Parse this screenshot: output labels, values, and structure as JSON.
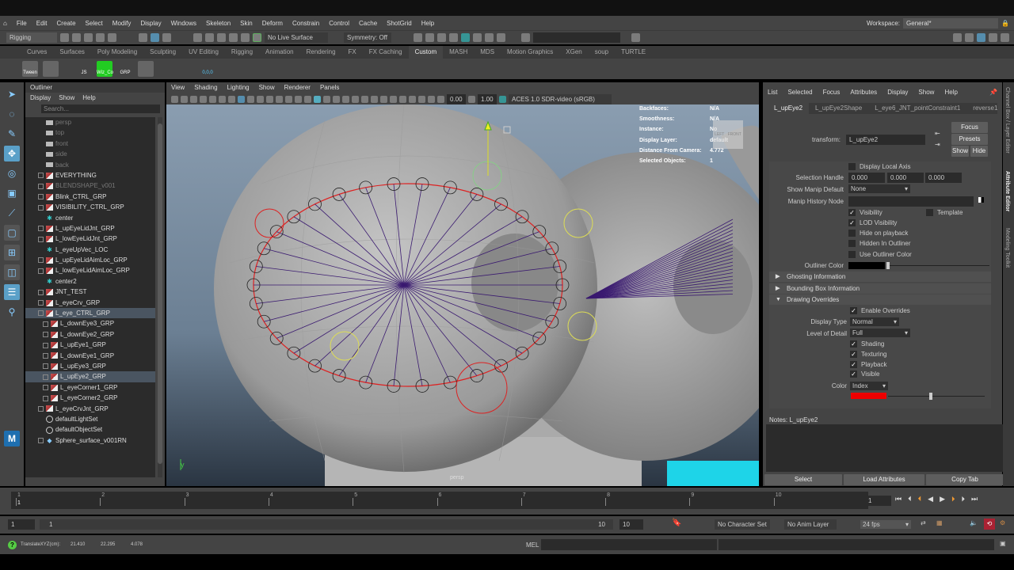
{
  "menubar": {
    "items": [
      "File",
      "Edit",
      "Create",
      "Select",
      "Modify",
      "Display",
      "Windows",
      "Skeleton",
      "Skin",
      "Deform",
      "Constrain",
      "Control",
      "Cache",
      "ShotGrid",
      "Help"
    ],
    "workspace_label": "Workspace:",
    "workspace_value": "General*"
  },
  "status_line": {
    "mode": "Rigging",
    "live_surface": "No Live Surface",
    "symmetry": "Symmetry: Off"
  },
  "shelf": {
    "tabs": [
      "Curves",
      "Surfaces",
      "Poly Modeling",
      "Sculpting",
      "UV Editing",
      "Rigging",
      "Animation",
      "Rendering",
      "FX",
      "FX Caching",
      "Custom",
      "MASH",
      "MDS",
      "Motion Graphics",
      "XGen",
      "soup",
      "TURTLE"
    ],
    "active_tab": "Custom",
    "buttons": [
      "Tween",
      "",
      "JS",
      "Wiz_Co",
      "GRP",
      "",
      "",
      "",
      "0,0,0"
    ]
  },
  "outliner": {
    "title": "Outliner",
    "menu": [
      "Display",
      "Show",
      "Help"
    ],
    "search_placeholder": "Search...",
    "items": [
      {
        "label": "persp",
        "type": "camera",
        "indent": 1,
        "dim": true
      },
      {
        "label": "top",
        "type": "camera",
        "indent": 1,
        "dim": true
      },
      {
        "label": "front",
        "type": "camera",
        "indent": 1,
        "dim": true
      },
      {
        "label": "side",
        "type": "camera",
        "indent": 1,
        "dim": true
      },
      {
        "label": "back",
        "type": "camera",
        "indent": 1,
        "dim": true
      },
      {
        "label": "EVERYTHING",
        "type": "group",
        "indent": 0
      },
      {
        "label": "BLENDSHAPE_v001",
        "type": "group",
        "indent": 0,
        "dim": true
      },
      {
        "label": "Blink_CTRL_GRP",
        "type": "group",
        "indent": 0
      },
      {
        "label": "VISIBILITY_CTRL_GRP",
        "type": "group",
        "indent": 0
      },
      {
        "label": "center",
        "type": "locator",
        "indent": 1
      },
      {
        "label": "L_upEyeLidJnt_GRP",
        "type": "group",
        "indent": 0
      },
      {
        "label": "L_lowEyeLidJnt_GRP",
        "type": "group",
        "indent": 0
      },
      {
        "label": "L_eyeUpVec_LOC",
        "type": "locator",
        "indent": 1
      },
      {
        "label": "L_upEyeLidAimLoc_GRP",
        "type": "group",
        "indent": 0
      },
      {
        "label": "L_lowEyeLidAimLoc_GRP",
        "type": "group",
        "indent": 0
      },
      {
        "label": "center2",
        "type": "locator",
        "indent": 1
      },
      {
        "label": "JNT_TEST",
        "type": "group",
        "indent": 0
      },
      {
        "label": "L_eyeCrv_GRP",
        "type": "group",
        "indent": 0
      },
      {
        "label": "L_eye_CTRL_GRP",
        "type": "group",
        "indent": 0,
        "selected": true
      },
      {
        "label": "L_downEye3_GRP",
        "type": "group",
        "indent": 2
      },
      {
        "label": "L_downEye2_GRP",
        "type": "group",
        "indent": 2
      },
      {
        "label": "L_upEye1_GRP",
        "type": "group",
        "indent": 2
      },
      {
        "label": "L_downEye1_GRP",
        "type": "group",
        "indent": 2
      },
      {
        "label": "L_upEye3_GRP",
        "type": "group",
        "indent": 2
      },
      {
        "label": "L_upEye2_GRP",
        "type": "group",
        "indent": 2,
        "selected": true
      },
      {
        "label": "L_eyeCorner1_GRP",
        "type": "group",
        "indent": 2
      },
      {
        "label": "L_eyeCorner2_GRP",
        "type": "group",
        "indent": 2
      },
      {
        "label": "L_eyeCrvJnt_GRP",
        "type": "group",
        "indent": 0
      },
      {
        "label": "defaultLightSet",
        "type": "set",
        "indent": 1
      },
      {
        "label": "defaultObjectSet",
        "type": "set",
        "indent": 1
      },
      {
        "label": "Sphere_surface_v001RN",
        "type": "reference",
        "indent": 0
      }
    ]
  },
  "viewport": {
    "menu": [
      "View",
      "Shading",
      "Lighting",
      "Show",
      "Renderer",
      "Panels"
    ],
    "exposure": "0.00",
    "gamma": "1.00",
    "color_space": "ACES 1.0 SDR-video (sRGB)",
    "camera_label": "persp",
    "cube_labels": [
      "LEFT",
      "FRONT"
    ],
    "hud": [
      {
        "label": "Backfaces:",
        "value": "N/A"
      },
      {
        "label": "Smoothness:",
        "value": "N/A"
      },
      {
        "label": "Instance:",
        "value": "No"
      },
      {
        "label": "Display Layer:",
        "value": "default"
      },
      {
        "label": "Distance From Camera:",
        "value": "4.772"
      },
      {
        "label": "Selected Objects:",
        "value": "1"
      }
    ]
  },
  "attribute_editor": {
    "menu": [
      "List",
      "Selected",
      "Focus",
      "Attributes",
      "Display",
      "Show",
      "Help"
    ],
    "tabs": [
      "L_upEye2",
      "L_upEye2Shape",
      "L_eye6_JNT_pointConstraint1",
      "reverse1"
    ],
    "active_tab": "L_upEye2",
    "transform_label": "transform:",
    "transform_value": "L_upEye2",
    "focus": "Focus",
    "presets": "Presets",
    "show": "Show",
    "hide": "Hide",
    "display_local_axis": "Display Local Axis",
    "selection_handle_label": "Selection Handle",
    "selection_handle": [
      "0.000",
      "0.000",
      "0.000"
    ],
    "show_manip_label": "Show Manip Default",
    "show_manip_value": "None",
    "manip_history_label": "Manip History Node",
    "visibility": "Visibility",
    "template": "Template",
    "lod_visibility": "LOD Visibility",
    "hide_on_playback": "Hide on playback",
    "hidden_in_outliner": "Hidden In Outliner",
    "use_outliner_color": "Use Outliner Color",
    "outliner_color_label": "Outliner Color",
    "sections": [
      "Ghosting Information",
      "Bounding Box Information",
      "Drawing Overrides"
    ],
    "enable_overrides": "Enable Overrides",
    "display_type_label": "Display Type",
    "display_type": "Normal",
    "lod_label": "Level of Detail",
    "lod": "Full",
    "shading": "Shading",
    "texturing": "Texturing",
    "playback": "Playback",
    "visible": "Visible",
    "color_label": "Color",
    "color_mode": "Index",
    "override_color": "#ee0000",
    "notes": "Notes:  L_upEye2",
    "select": "Select",
    "load_attributes": "Load Attributes",
    "copy_tab": "Copy Tab"
  },
  "side_tabs": [
    "Channel Box / Layer Editor",
    "Attribute Editor",
    "Modeling Toolkit"
  ],
  "timeline": {
    "ticks": [
      "1",
      "2",
      "3",
      "4",
      "5",
      "6",
      "7",
      "8",
      "9",
      "10"
    ],
    "current_frame": "1",
    "current_frame_field": "1"
  },
  "range": {
    "start": "1",
    "inner_start": "1",
    "inner_end": "10",
    "end": "10",
    "character_set": "No Character Set",
    "anim_layer": "No Anim Layer",
    "fps": "24 fps"
  },
  "command": {
    "help_text": "TranslateXYZ(cm):",
    "x": "21.410",
    "y": "22.295",
    "z": "4.078",
    "lang": "MEL"
  }
}
